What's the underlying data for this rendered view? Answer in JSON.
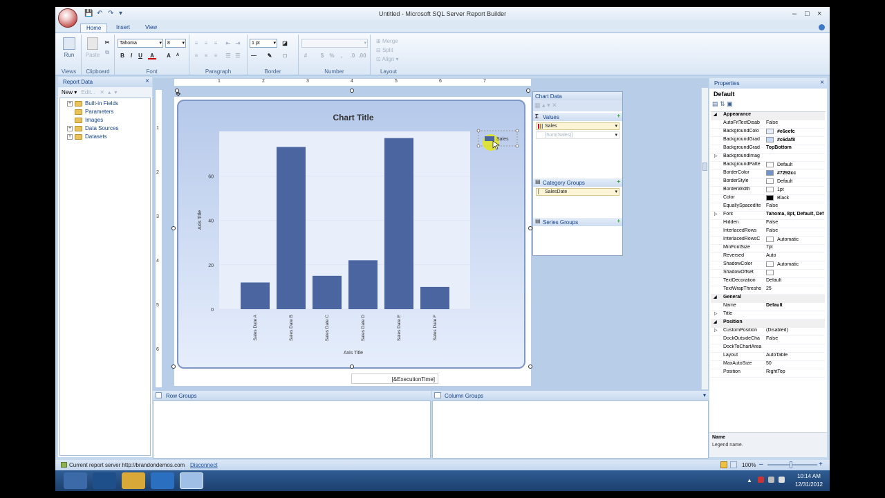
{
  "window": {
    "title": "Untitled - Microsoft SQL Server Report Builder",
    "min": "–",
    "max": "□",
    "close": "×"
  },
  "qat": {
    "save": "💾",
    "undo": "↶",
    "redo": "↷",
    "dropdown": "▾"
  },
  "tabs": [
    {
      "label": "Home"
    },
    {
      "label": "Insert"
    },
    {
      "label": "View"
    }
  ],
  "ribbon": {
    "run": "Run",
    "paste": "Paste",
    "groups": {
      "views": "Views",
      "clipboard": "Clipboard",
      "font": "Font",
      "paragraph": "Paragraph",
      "border": "Border",
      "number": "Number",
      "layout": "Layout"
    },
    "font_name": "Tahoma",
    "font_size": "8",
    "border_width": "1 pt",
    "merge": "Merge",
    "split": "Split",
    "align": "Align"
  },
  "report_data": {
    "title": "Report Data",
    "new": "New",
    "edit": "Edit...",
    "items": [
      {
        "label": "Built-in Fields",
        "exp": "+"
      },
      {
        "label": "Parameters",
        "exp": ""
      },
      {
        "label": "Images",
        "exp": ""
      },
      {
        "label": "Data Sources",
        "exp": "+"
      },
      {
        "label": "Datasets",
        "exp": "+"
      }
    ]
  },
  "rulers": {
    "h": [
      "1",
      "2",
      "3",
      "4",
      "5",
      "6",
      "7"
    ],
    "v": [
      "1",
      "2",
      "3",
      "4",
      "5",
      "6"
    ]
  },
  "chart_data": {
    "type": "bar",
    "title": "Chart Title",
    "xlabel": "Axis Title",
    "ylabel": "Axis Title",
    "categories": [
      "Sales Date A",
      "Sales Date B",
      "Sales Date C",
      "Sales Date D",
      "Sales Date E",
      "Sales Date F"
    ],
    "series": [
      {
        "name": "Sales",
        "values": [
          12,
          73,
          15,
          22,
          77,
          10
        ],
        "color": "#4a65a0"
      }
    ],
    "yticks": [
      0,
      20,
      40,
      60
    ],
    "ylim": [
      0,
      80
    ],
    "legend": "top-right",
    "grid": true
  },
  "textbox": "[&ExecutionTime]",
  "chart_panel": {
    "title": "Chart Data",
    "values": "Values",
    "values_icon": "Σ",
    "series_field": "Sales",
    "series_expr": "[Sum(Sales)]",
    "category_groups": "Category Groups",
    "category_field": "SalesDate",
    "series_groups": "Series Groups",
    "add": "+"
  },
  "groupings": {
    "row": "Row Groups",
    "column": "Column Groups"
  },
  "properties": {
    "title": "Properties",
    "object": "Default",
    "rows": [
      {
        "kind": "cat",
        "name": "Appearance"
      },
      {
        "name": "AutoFitTextDisab",
        "value": "False"
      },
      {
        "name": "BackgroundColo",
        "value": "#e6eefc",
        "swatch": "#e6eefc",
        "bold": true
      },
      {
        "name": "BackgroundGrad",
        "value": "#c6daf8",
        "swatch": "#c6daf8",
        "bold": true
      },
      {
        "name": "BackgroundGrad",
        "value": "TopBottom",
        "bold": true
      },
      {
        "name": "BackgroundImag",
        "value": "",
        "exp": "▷"
      },
      {
        "name": "BackgroundPatte",
        "value": "Default",
        "swatch": "#ffffff"
      },
      {
        "name": "BorderColor",
        "value": "#7292cc",
        "swatch": "#7292cc",
        "bold": true
      },
      {
        "name": "BorderStyle",
        "value": "Default",
        "swatch": "#ffffff"
      },
      {
        "name": "BorderWidth",
        "value": "1pt",
        "swatch": "#ffffff"
      },
      {
        "name": "Color",
        "value": "Black",
        "swatch": "#000000"
      },
      {
        "name": "EquallySpacedIte",
        "value": "False"
      },
      {
        "name": "Font",
        "value": "Tahoma, 8pt, Default, Def",
        "bold": true,
        "exp": "▷"
      },
      {
        "name": "Hidden",
        "value": "False"
      },
      {
        "name": "InterlacedRows",
        "value": "False"
      },
      {
        "name": "InterlacedRowsC",
        "value": "Automatic",
        "swatch": "#ffffff"
      },
      {
        "name": "MinFontSize",
        "value": "7pt"
      },
      {
        "name": "Reversed",
        "value": "Auto"
      },
      {
        "name": "ShadowColor",
        "value": "Automatic",
        "swatch": "#ffffff"
      },
      {
        "name": "ShadowOffset",
        "value": "",
        "swatch": "#ffffff"
      },
      {
        "name": "TextDecoration",
        "value": "Default"
      },
      {
        "name": "TextWrapThresho",
        "value": "25"
      },
      {
        "kind": "cat",
        "name": "General"
      },
      {
        "name": "Name",
        "value": "Default",
        "bold": true
      },
      {
        "name": "Title",
        "value": "",
        "exp": "▷"
      },
      {
        "kind": "cat",
        "name": "Position"
      },
      {
        "name": "CustomPosition",
        "value": "(Disabled)",
        "exp": "▷"
      },
      {
        "name": "DockOutsideCha",
        "value": "False"
      },
      {
        "name": "DockToChartArea",
        "value": ""
      },
      {
        "name": "Layout",
        "value": "AutoTable"
      },
      {
        "name": "MaxAutoSize",
        "value": "50"
      },
      {
        "name": "Position",
        "value": "RightTop"
      }
    ],
    "help_title": "Name",
    "help_text": "Legend name."
  },
  "status": {
    "text": "Current report server http://brandondemos.com",
    "link": "Disconnect",
    "zoom": "100%",
    "minus": "–",
    "plus": "+"
  },
  "clock": {
    "time": "10:14 AM",
    "date": "12/31/2012"
  }
}
